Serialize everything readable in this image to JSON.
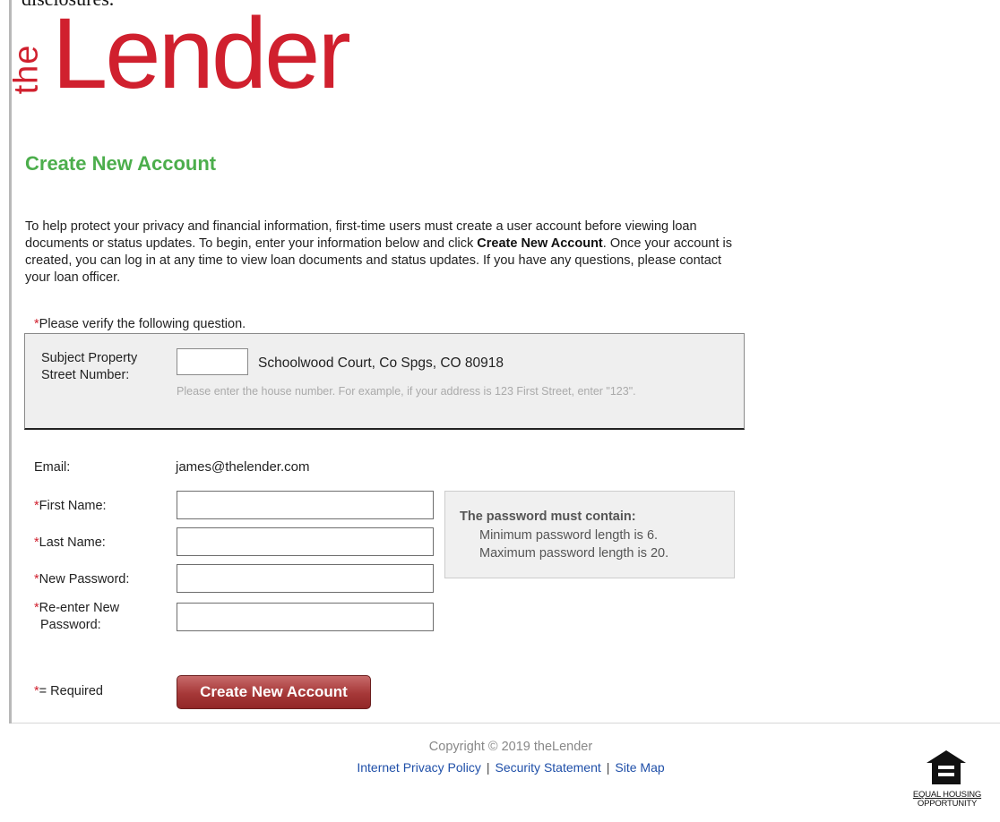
{
  "header": {
    "top_clipped_text": "disclosures.",
    "logo_the": "the",
    "logo_lender": "Lender"
  },
  "page": {
    "title": "Create New Account",
    "intro_part1": "To help protect your privacy and financial information, first-time users must create a user account before viewing loan documents or status updates. To begin, enter your information below and click ",
    "intro_bold": "Create New Account",
    "intro_part2": ". Once your account is created, you can log in at any time to view loan documents and status updates. If you have any questions, please contact your loan officer."
  },
  "verification": {
    "asterisk": "*",
    "prompt": "Please verify the following question.",
    "field_label_line1": "Subject Property",
    "field_label_line2": "Street Number:",
    "street_number_value": "",
    "street_suffix": "Schoolwood Court, Co Spgs, CO 80918",
    "hint": "Please enter the house number. For example, if your address is 123 First Street, enter \"123\"."
  },
  "form": {
    "asterisk": "*",
    "email_label": "Email:",
    "email_value": "james@thelender.com",
    "first_name_label": "First Name:",
    "first_name_value": "",
    "last_name_label": "Last Name:",
    "last_name_value": "",
    "new_password_label": "New Password:",
    "new_password_value": "",
    "reenter_label_line1": "Re-enter New",
    "reenter_label_line2": "Password:",
    "reenter_value": "",
    "required_note": "= Required",
    "submit_label": "Create New Account"
  },
  "password_rules": {
    "title": "The password must contain:",
    "rules": [
      "Minimum password length is 6.",
      "Maximum password length is 20."
    ]
  },
  "footer": {
    "copyright": "Copyright © 2019 theLender",
    "links": {
      "privacy": "Internet Privacy Policy",
      "security": "Security Statement",
      "sitemap": "Site Map"
    },
    "separator": "|",
    "eho_line1": "EQUAL HOUSING",
    "eho_line2": "OPPORTUNITY"
  },
  "colors": {
    "brand_red": "#d0202e",
    "title_green": "#4cae4c",
    "link_blue": "#1f4fa8",
    "button_red": "#a63838"
  },
  "icons": {
    "equal_housing": "equal-housing-house-icon"
  }
}
